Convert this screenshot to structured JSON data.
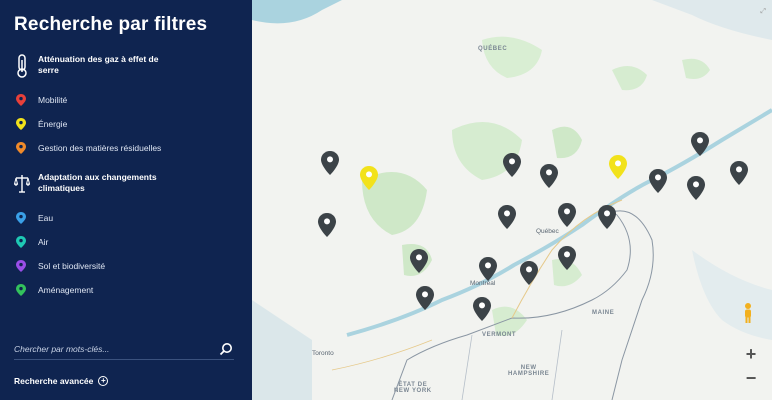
{
  "sidebar": {
    "title": "Recherche par filtres",
    "sections": [
      {
        "label": "Atténuation des gaz à effet de serre",
        "icon": "thermometer-icon",
        "items": [
          {
            "label": "Mobilité",
            "color": "#e8403a"
          },
          {
            "label": "Énergie",
            "color": "#f2e21b"
          },
          {
            "label": "Gestion des matières résiduelles",
            "color": "#f08a2a"
          }
        ]
      },
      {
        "label": "Adaptation aux changements climatiques",
        "icon": "balance-scale-icon",
        "items": [
          {
            "label": "Eau",
            "color": "#3aa0e8"
          },
          {
            "label": "Air",
            "color": "#1ec9b4"
          },
          {
            "label": "Sol et biodiversité",
            "color": "#9a4ee8"
          },
          {
            "label": "Aménagement",
            "color": "#33c25c"
          }
        ]
      }
    ],
    "search": {
      "placeholder": "Chercher par mots-clés..."
    },
    "advanced_search": "Recherche avancée"
  },
  "map": {
    "labels": {
      "quebec_region": "QUÉBEC",
      "quebec_city": "Québec",
      "montreal": "Montréal",
      "maine": "MAINE",
      "vermont": "VERMONT",
      "new_hampshire": "NEW\nHAMPSHIRE",
      "etat_ny": "ÉTAT DE\nNEW YORK",
      "toronto": "Toronto"
    },
    "colors": {
      "marker_dark": "#3c4348",
      "marker_energy": "#f2e21b",
      "land": "#f2f3f0",
      "park": "#cfe8c8",
      "water": "#aad3df"
    },
    "zoom_in": "+",
    "zoom_out": "−"
  }
}
